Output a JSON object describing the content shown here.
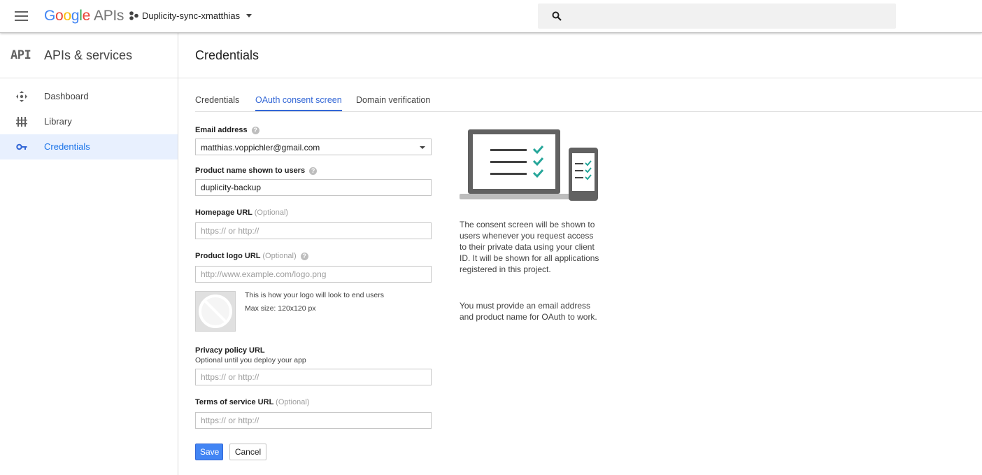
{
  "topbar": {
    "logo_google": [
      "G",
      "o",
      "o",
      "g",
      "l",
      "e"
    ],
    "logo_apis": "APIs",
    "project_name": "Duplicity-sync-xmatthias",
    "search_placeholder": ""
  },
  "sidebar": {
    "api_logo": "API",
    "title": "APIs & services",
    "items": [
      {
        "label": "Dashboard",
        "icon": "dashboard-icon"
      },
      {
        "label": "Library",
        "icon": "library-icon"
      },
      {
        "label": "Credentials",
        "icon": "key-icon",
        "active": true
      }
    ]
  },
  "main": {
    "page_title": "Credentials",
    "tabs": [
      {
        "label": "Credentials"
      },
      {
        "label": "OAuth consent screen",
        "active": true
      },
      {
        "label": "Domain verification"
      }
    ],
    "form": {
      "email_label": "Email address",
      "email_value": "matthias.voppichler@gmail.com",
      "product_name_label": "Product name shown to users",
      "product_name_value": "duplicity-backup",
      "homepage_label": "Homepage URL",
      "optional": "(Optional)",
      "homepage_placeholder": "https:// or http://",
      "logo_label": "Product logo URL",
      "logo_placeholder": "http://www.example.com/logo.png",
      "logo_note_1": "This is how your logo will look to end users",
      "logo_note_2": "Max size: 120x120 px",
      "privacy_label": "Privacy policy URL",
      "privacy_sub": "Optional until you deploy your app",
      "privacy_placeholder": "https:// or http://",
      "tos_label": "Terms of service URL",
      "tos_placeholder": "https:// or http://",
      "save_label": "Save",
      "cancel_label": "Cancel"
    },
    "info": {
      "paragraph_1": "The consent screen will be shown to users whenever you request access to their private data using your client ID. It will be shown for all applications registered in this project.",
      "paragraph_2": "You must provide an email address and product name for OAuth to work."
    }
  },
  "colors": {
    "accent": "#3367d6",
    "save_button": "#4285f4",
    "active_nav_bg": "#e8f0fe",
    "check_teal": "#26a69a"
  }
}
